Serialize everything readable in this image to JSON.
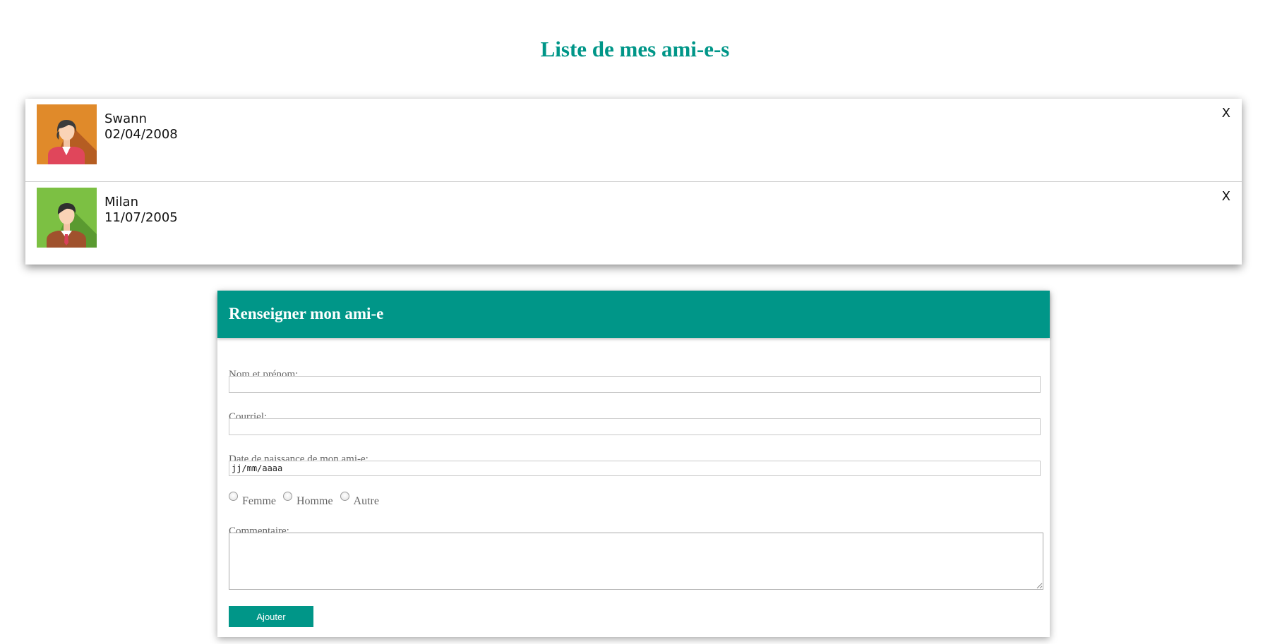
{
  "page": {
    "title": "Liste de mes ami-e-s",
    "accent_color": "#009688"
  },
  "friends": [
    {
      "name": "Swann",
      "birthdate": "02/04/2008",
      "avatar_icon": "female-avatar-icon",
      "avatar_bg": "#e08a2a",
      "delete_label": "X"
    },
    {
      "name": "Milan",
      "birthdate": "11/07/2005",
      "avatar_icon": "male-avatar-icon",
      "avatar_bg": "#7cc043",
      "delete_label": "X"
    }
  ],
  "form": {
    "header": "Renseigner mon ami-e",
    "name_label": "Nom et prénom:",
    "name_value": "",
    "email_label": "Courriel:",
    "email_value": "",
    "birthdate_label": "Date de naissance de mon ami-e:",
    "birthdate_value": "jj/mm/aaaa",
    "gender_options": [
      "Femme",
      "Homme",
      "Autre"
    ],
    "comment_label": "Commentaire:",
    "comment_value": "",
    "submit_label": "Ajouter"
  }
}
